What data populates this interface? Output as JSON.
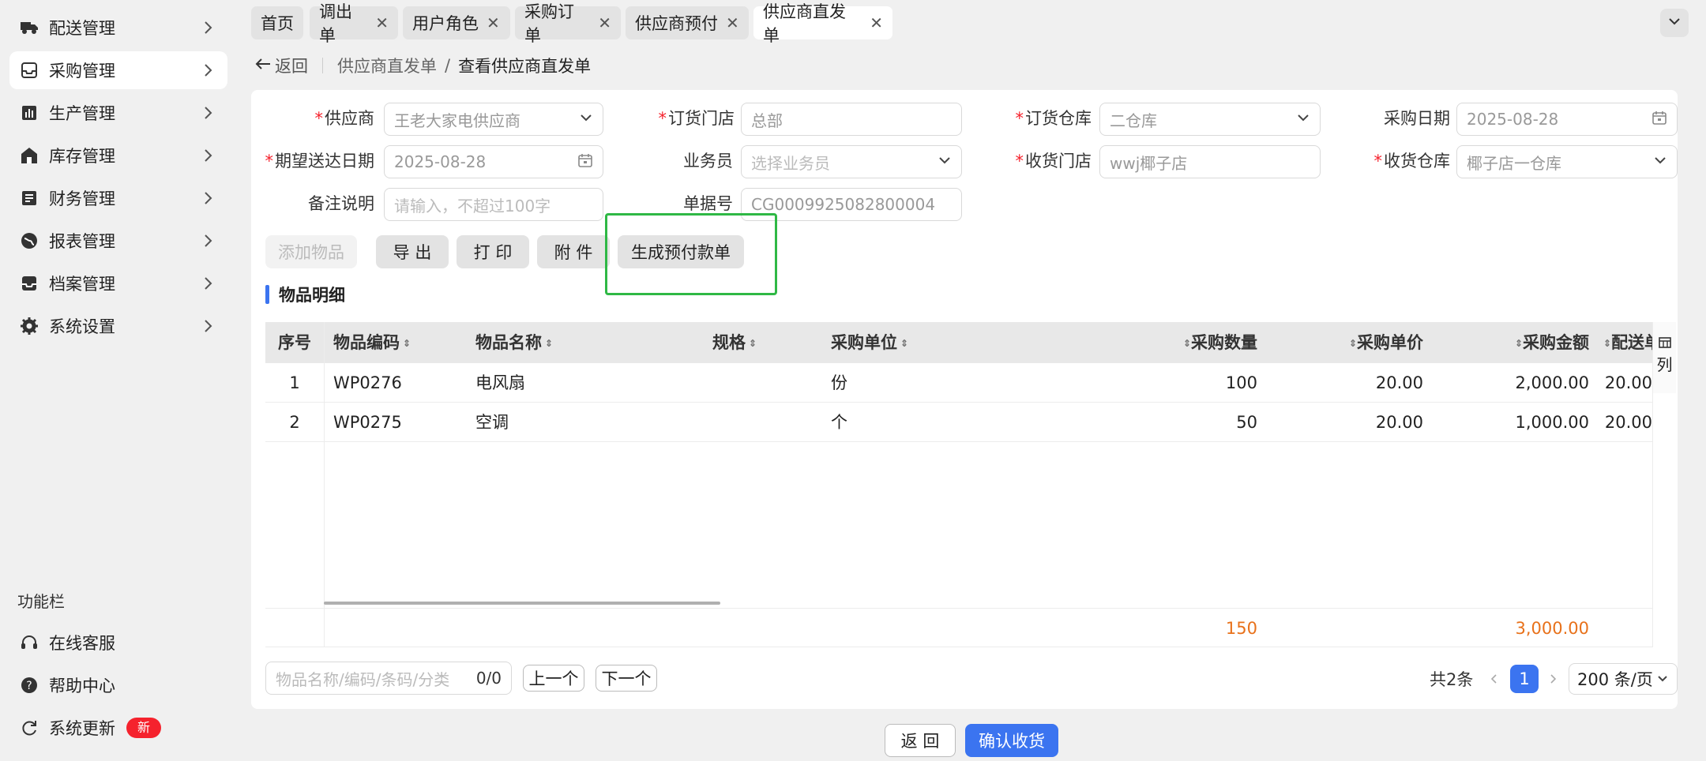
{
  "sidebar": {
    "items": [
      {
        "label": "配送管理",
        "icon": "truck-icon"
      },
      {
        "label": "采购管理",
        "icon": "inbox-icon"
      },
      {
        "label": "生产管理",
        "icon": "bar-chart-icon"
      },
      {
        "label": "库存管理",
        "icon": "house-icon"
      },
      {
        "label": "财务管理",
        "icon": "ledger-icon"
      },
      {
        "label": "报表管理",
        "icon": "globe-icon"
      },
      {
        "label": "档案管理",
        "icon": "tray-icon"
      },
      {
        "label": "系统设置",
        "icon": "gear-icon"
      }
    ],
    "function_title": "功能栏",
    "function_items": [
      {
        "label": "在线客服",
        "icon": "headset-icon"
      },
      {
        "label": "帮助中心",
        "icon": "help-icon"
      },
      {
        "label": "系统更新",
        "icon": "refresh-icon",
        "badge": "新"
      }
    ]
  },
  "tabs": [
    {
      "label": "首页",
      "closable": false
    },
    {
      "label": "调出单",
      "closable": true
    },
    {
      "label": "用户角色",
      "closable": true
    },
    {
      "label": "采购订单",
      "closable": true
    },
    {
      "label": "供应商预付",
      "closable": true
    },
    {
      "label": "供应商直发单",
      "closable": true,
      "active": true
    }
  ],
  "breadcrumb": {
    "back": "返回",
    "parent": "供应商直发单",
    "separator": "/",
    "current": "查看供应商直发单"
  },
  "form": {
    "supplier_label": "供应商",
    "supplier_value": "王老大家电供应商",
    "order_store_label": "订货门店",
    "order_store_value": "总部",
    "order_warehouse_label": "订货仓库",
    "order_warehouse_value": "二仓库",
    "purchase_date_label": "采购日期",
    "purchase_date_value": "2025-08-28",
    "expected_date_label": "期望送达日期",
    "expected_date_value": "2025-08-28",
    "salesman_label": "业务员",
    "salesman_placeholder": "选择业务员",
    "receive_store_label": "收货门店",
    "receive_store_value": "wwj椰子店",
    "receive_warehouse_label": "收货仓库",
    "receive_warehouse_value": "椰子店一仓库",
    "remark_label": "备注说明",
    "remark_placeholder": "请输入，不超过100字",
    "doc_no_label": "单据号",
    "doc_no_value": "CG0009925082800004"
  },
  "actions": {
    "add_item": "添加物品",
    "export": "导 出",
    "print": "打 印",
    "attach": "附 件",
    "gen_prepay": "生成预付款单"
  },
  "section_title": "物品明细",
  "table": {
    "columns": [
      "序号",
      "物品编码",
      "物品名称",
      "规格",
      "采购单位",
      "采购数量",
      "采购单价",
      "采购金额",
      "配送单价"
    ],
    "column_settings": "列",
    "rows": [
      {
        "no": "1",
        "code": "WP0276",
        "name": "电风扇",
        "spec": "",
        "unit": "份",
        "qty": "100",
        "price": "20.00",
        "amount": "2,000.00",
        "dprice": "20.00"
      },
      {
        "no": "2",
        "code": "WP0275",
        "name": "空调",
        "spec": "",
        "unit": "个",
        "qty": "50",
        "price": "20.00",
        "amount": "1,000.00",
        "dprice": "20.00"
      }
    ],
    "summary": {
      "qty": "150",
      "amount": "3,000.00"
    }
  },
  "footer": {
    "search_placeholder": "物品名称/编码/条码/分类",
    "search_count": "0/0",
    "prev": "上一个",
    "next": "下一个",
    "total": "共2条",
    "page": "1",
    "page_size": "200 条/页"
  },
  "bottom": {
    "back": "返 回",
    "confirm": "确认收货"
  },
  "colors": {
    "primary": "#3b74f0",
    "highlight_box": "#2fb845",
    "summary": "#e8711a",
    "required": "#f5222d"
  }
}
